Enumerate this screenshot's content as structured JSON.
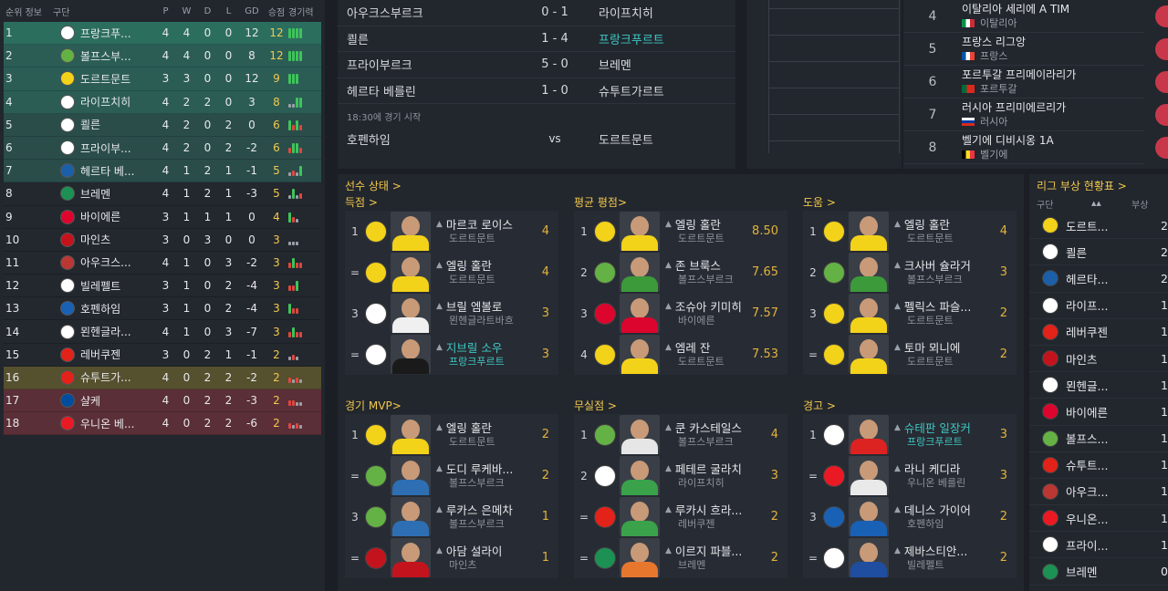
{
  "league_table": {
    "headers": {
      "pos": "순위",
      "info": "정보",
      "team": "구단",
      "p": "P",
      "w": "W",
      "d": "D",
      "l": "L",
      "gd": "GD",
      "pts": "승점",
      "form": "경기력"
    },
    "rows": [
      {
        "pos": "1",
        "team": "프랑크푸...",
        "crest": "eintracht-crest",
        "crest_color": "#ffffff",
        "p": "4",
        "w": "4",
        "d": "0",
        "l": "0",
        "gd": "12",
        "pts": "12",
        "row_bg": "#2c6e5e",
        "form": [
          "w",
          "w",
          "w",
          "w"
        ]
      },
      {
        "pos": "2",
        "team": "볼프스부...",
        "crest": "wolfsburg-crest",
        "crest_color": "#64b245",
        "p": "4",
        "w": "4",
        "d": "0",
        "l": "0",
        "gd": "8",
        "pts": "12",
        "row_bg": "#2b5d55",
        "form": [
          "w",
          "w",
          "w",
          "w"
        ]
      },
      {
        "pos": "3",
        "team": "도르트문트",
        "crest": "dortmund-crest",
        "crest_color": "#f3d21a",
        "p": "3",
        "w": "3",
        "d": "0",
        "l": "0",
        "gd": "12",
        "pts": "9",
        "row_bg": "#2b5d55",
        "form": [
          "w",
          "w",
          "w"
        ]
      },
      {
        "pos": "4",
        "team": "라이프치히",
        "crest": "leipzig-crest",
        "crest_color": "#ffffff",
        "p": "4",
        "w": "2",
        "d": "2",
        "l": "0",
        "gd": "3",
        "pts": "8",
        "row_bg": "#2b5d55",
        "form": [
          "d",
          "d",
          "w",
          "w"
        ]
      },
      {
        "pos": "5",
        "team": "쾰른",
        "crest": "koln-crest",
        "crest_color": "#ffffff",
        "p": "4",
        "w": "2",
        "d": "0",
        "l": "2",
        "gd": "0",
        "pts": "6",
        "row_bg": "#2a4d4a",
        "form": [
          "w",
          "l",
          "w",
          "l"
        ]
      },
      {
        "pos": "6",
        "team": "프라이부...",
        "crest": "freiburg-crest",
        "crest_color": "#ffffff",
        "p": "4",
        "w": "2",
        "d": "0",
        "l": "2",
        "gd": "-2",
        "pts": "6",
        "row_bg": "#2a4d4a",
        "form": [
          "l",
          "w",
          "w",
          "l"
        ]
      },
      {
        "pos": "7",
        "team": "헤르타 베...",
        "crest": "hertha-crest",
        "crest_color": "#1b5fa8",
        "p": "4",
        "w": "1",
        "d": "2",
        "l": "1",
        "gd": "-1",
        "pts": "5",
        "row_bg": "#2a4d4a",
        "form": [
          "d",
          "l",
          "d",
          "w"
        ]
      },
      {
        "pos": "8",
        "team": "브레멘",
        "crest": "bremen-crest",
        "crest_color": "#1d9053",
        "p": "4",
        "w": "1",
        "d": "2",
        "l": "1",
        "gd": "-3",
        "pts": "5",
        "row_bg": "#23272e",
        "form": [
          "d",
          "w",
          "d",
          "l"
        ]
      },
      {
        "pos": "9",
        "team": "바이에른",
        "crest": "bayern-crest",
        "crest_color": "#dc052d",
        "p": "3",
        "w": "1",
        "d": "1",
        "l": "1",
        "gd": "0",
        "pts": "4",
        "row_bg": "#23272e",
        "form": [
          "w",
          "l",
          "d"
        ]
      },
      {
        "pos": "10",
        "team": "마인츠",
        "crest": "mainz-crest",
        "crest_color": "#c3141e",
        "p": "3",
        "w": "0",
        "d": "3",
        "l": "0",
        "gd": "0",
        "pts": "3",
        "row_bg": "#23272e",
        "form": [
          "d",
          "d",
          "d"
        ]
      },
      {
        "pos": "11",
        "team": "아우크스...",
        "crest": "augsburg-crest",
        "crest_color": "#ba3733",
        "p": "4",
        "w": "1",
        "d": "0",
        "l": "3",
        "gd": "-2",
        "pts": "3",
        "row_bg": "#23272e",
        "form": [
          "l",
          "w",
          "l",
          "l"
        ]
      },
      {
        "pos": "12",
        "team": "빌레펠트",
        "crest": "bielefeld-crest",
        "crest_color": "#ffffff",
        "p": "3",
        "w": "1",
        "d": "0",
        "l": "2",
        "gd": "-4",
        "pts": "3",
        "row_bg": "#23272e",
        "form": [
          "l",
          "l",
          "w"
        ]
      },
      {
        "pos": "13",
        "team": "호펜하임",
        "crest": "hoffenheim-crest",
        "crest_color": "#1961b5",
        "p": "3",
        "w": "1",
        "d": "0",
        "l": "2",
        "gd": "-4",
        "pts": "3",
        "row_bg": "#23272e",
        "form": [
          "w",
          "l",
          "l"
        ]
      },
      {
        "pos": "14",
        "team": "묀헨글라...",
        "crest": "gladbach-crest",
        "crest_color": "#ffffff",
        "p": "4",
        "w": "1",
        "d": "0",
        "l": "3",
        "gd": "-7",
        "pts": "3",
        "row_bg": "#23272e",
        "form": [
          "l",
          "w",
          "l",
          "l"
        ]
      },
      {
        "pos": "15",
        "team": "레버쿠젠",
        "crest": "leverkusen-crest",
        "crest_color": "#e32219",
        "p": "3",
        "w": "0",
        "d": "2",
        "l": "1",
        "gd": "-1",
        "pts": "2",
        "row_bg": "#23272e",
        "form": [
          "d",
          "l",
          "d"
        ]
      },
      {
        "pos": "16",
        "team": "슈투트가...",
        "crest": "stuttgart-crest",
        "crest_color": "#e32219",
        "p": "4",
        "w": "0",
        "d": "2",
        "l": "2",
        "gd": "-2",
        "pts": "2",
        "row_bg": "#55502e",
        "form": [
          "l",
          "d",
          "l",
          "d"
        ]
      },
      {
        "pos": "17",
        "team": "샬케",
        "crest": "schalke-crest",
        "crest_color": "#004d9d",
        "p": "4",
        "w": "0",
        "d": "2",
        "l": "2",
        "gd": "-3",
        "pts": "2",
        "row_bg": "#5b2f37",
        "form": [
          "l",
          "l",
          "d",
          "d"
        ]
      },
      {
        "pos": "18",
        "team": "우니온 베...",
        "crest": "union-crest",
        "crest_color": "#eb1923",
        "p": "4",
        "w": "0",
        "d": "2",
        "l": "2",
        "gd": "-6",
        "pts": "2",
        "row_bg": "#5b2f37",
        "form": [
          "l",
          "d",
          "l",
          "d"
        ]
      }
    ]
  },
  "fixtures": {
    "rows": [
      {
        "home": "아우크스부르크",
        "score": "0 - 1",
        "away": "라이프치히",
        "away_hl": false
      },
      {
        "home": "쾰른",
        "score": "1 - 4",
        "away": "프랑크푸르트",
        "away_hl": true
      },
      {
        "home": "프라이부르크",
        "score": "5 - 0",
        "away": "브레멘",
        "away_hl": false
      },
      {
        "home": "헤르타 베를린",
        "score": "1 - 0",
        "away": "슈투트가르트",
        "away_hl": false
      }
    ],
    "note": "18:30에 경기 시작",
    "upcoming": {
      "home": "호펜하임",
      "vs": "vs",
      "away": "도르트문트"
    }
  },
  "rankings": [
    {
      "num": "4",
      "name": "이탈리아 세리에 A TIM",
      "country": "이탈리아",
      "flag": "italy-flag"
    },
    {
      "num": "5",
      "name": "프랑스 리그앙",
      "country": "프랑스",
      "flag": "france-flag"
    },
    {
      "num": "6",
      "name": "포르투갈 프리메이라리가",
      "country": "포르투갈",
      "flag": "portugal-flag"
    },
    {
      "num": "7",
      "name": "러시아 프리미에르리가",
      "country": "러시아",
      "flag": "russia-flag"
    },
    {
      "num": "8",
      "name": "벨기에 디비시옹 1A",
      "country": "벨기에",
      "flag": "belgium-flag"
    }
  ],
  "stats": {
    "title": "선수 상태 >",
    "categories": [
      {
        "title": "득점  >",
        "players": [
          {
            "rank": "1",
            "crest": "dortmund-crest",
            "crest_color": "#f3d21a",
            "shirt": "#f3d21a",
            "name": "마르코 로이스",
            "team": "도르트문트",
            "value": "4",
            "hl": false
          },
          {
            "rank": "=",
            "crest": "dortmund-crest",
            "crest_color": "#f3d21a",
            "shirt": "#f3d21a",
            "name": "엘링 홀란",
            "team": "도르트문트",
            "value": "4",
            "hl": false
          },
          {
            "rank": "3",
            "crest": "gladbach-crest",
            "crest_color": "#ffffff",
            "shirt": "#f0f0f0",
            "name": "브릴 엠볼로",
            "team": "묀헨글라트바흐",
            "value": "3",
            "hl": false
          },
          {
            "rank": "=",
            "crest": "eintracht-crest",
            "crest_color": "#ffffff",
            "shirt": "#1a1a1a",
            "name": "지브릴 소우",
            "team": "프랑크푸르트",
            "value": "3",
            "hl": true
          }
        ]
      },
      {
        "title": "평균 평점>",
        "players": [
          {
            "rank": "1",
            "crest": "dortmund-crest",
            "crest_color": "#f3d21a",
            "shirt": "#f3d21a",
            "name": "엘링 홀란",
            "team": "도르트문트",
            "value": "8.50",
            "hl": false
          },
          {
            "rank": "2",
            "crest": "wolfsburg-crest",
            "crest_color": "#64b245",
            "shirt": "#3d9a3a",
            "name": "존 브룩스",
            "team": "볼프스부르크",
            "value": "7.65",
            "hl": false
          },
          {
            "rank": "3",
            "crest": "bayern-crest",
            "crest_color": "#dc052d",
            "shirt": "#dc052d",
            "name": "조슈아 키미히",
            "team": "바이에른",
            "value": "7.57",
            "hl": false
          },
          {
            "rank": "4",
            "crest": "dortmund-crest",
            "crest_color": "#f3d21a",
            "shirt": "#f3d21a",
            "name": "엠레 잔",
            "team": "도르트문트",
            "value": "7.53",
            "hl": false
          }
        ]
      },
      {
        "title": "도움  >",
        "players": [
          {
            "rank": "1",
            "crest": "dortmund-crest",
            "crest_color": "#f3d21a",
            "shirt": "#f3d21a",
            "name": "엘링 홀란",
            "team": "도르트문트",
            "value": "4",
            "hl": false
          },
          {
            "rank": "2",
            "crest": "wolfsburg-crest",
            "crest_color": "#64b245",
            "shirt": "#3d9a3a",
            "name": "크사버 슐라거",
            "team": "볼프스부르크",
            "value": "3",
            "hl": false
          },
          {
            "rank": "3",
            "crest": "dortmund-crest",
            "crest_color": "#f3d21a",
            "shirt": "#f3d21a",
            "name": "펠릭스 파슬...",
            "team": "도르트문트",
            "value": "2",
            "hl": false
          },
          {
            "rank": "=",
            "crest": "dortmund-crest",
            "crest_color": "#f3d21a",
            "shirt": "#f3d21a",
            "name": "토마 뫼니에",
            "team": "도르트문트",
            "value": "2",
            "hl": false
          }
        ]
      },
      {
        "title": "경기 MVP>",
        "players": [
          {
            "rank": "1",
            "crest": "dortmund-crest",
            "crest_color": "#f3d21a",
            "shirt": "#f3d21a",
            "name": "엘링 홀란",
            "team": "도르트문트",
            "value": "2",
            "hl": false
          },
          {
            "rank": "=",
            "crest": "wolfsburg-crest",
            "crest_color": "#64b245",
            "shirt": "#2e6fb3",
            "name": "도디 루케바...",
            "team": "볼프스부르크",
            "value": "2",
            "hl": false
          },
          {
            "rank": "3",
            "crest": "wolfsburg-crest",
            "crest_color": "#64b245",
            "shirt": "#2e6fb3",
            "name": "루카스 은메차",
            "team": "볼프스부르크",
            "value": "1",
            "hl": false
          },
          {
            "rank": "=",
            "crest": "mainz-crest",
            "crest_color": "#c3141e",
            "shirt": "#c3141e",
            "name": "아담 설라이",
            "team": "마인츠",
            "value": "1",
            "hl": false
          }
        ]
      },
      {
        "title": "무실점 >",
        "players": [
          {
            "rank": "1",
            "crest": "wolfsburg-crest",
            "crest_color": "#64b245",
            "shirt": "#e6e6e6",
            "name": "쿤 카스테일스",
            "team": "볼프스부르크",
            "value": "4",
            "hl": false
          },
          {
            "rank": "2",
            "crest": "leipzig-crest",
            "crest_color": "#ffffff",
            "shirt": "#3aa24a",
            "name": "페테르 굴라치",
            "team": "라이프치히",
            "value": "3",
            "hl": false
          },
          {
            "rank": "=",
            "crest": "leverkusen-crest",
            "crest_color": "#e32219",
            "shirt": "#3aa24a",
            "name": "루카시 흐라...",
            "team": "레버쿠젠",
            "value": "2",
            "hl": false
          },
          {
            "rank": "=",
            "crest": "bremen-crest",
            "crest_color": "#1d9053",
            "shirt": "#e8772e",
            "name": "이르지 파블...",
            "team": "브레멘",
            "value": "2",
            "hl": false
          }
        ]
      },
      {
        "title": "경고  >",
        "players": [
          {
            "rank": "1",
            "crest": "eintracht-crest",
            "crest_color": "#ffffff",
            "shirt": "#d22",
            "name": "슈테판 일장커",
            "team": "프랑크푸르트",
            "value": "3",
            "hl": true
          },
          {
            "rank": "=",
            "crest": "union-crest",
            "crest_color": "#eb1923",
            "shirt": "#e9e9e9",
            "name": "라니 케디라",
            "team": "우니온 베를린",
            "value": "3",
            "hl": false
          },
          {
            "rank": "3",
            "crest": "hoffenheim-crest",
            "crest_color": "#1961b5",
            "shirt": "#1961b5",
            "name": "데니스 가이어",
            "team": "호펜하임",
            "value": "2",
            "hl": false
          },
          {
            "rank": "=",
            "crest": "bielefeld-crest",
            "crest_color": "#ffffff",
            "shirt": "#1f4ea0",
            "name": "제바스티안...",
            "team": "빌레펠트",
            "value": "2",
            "hl": false
          }
        ]
      }
    ]
  },
  "injury": {
    "title": "리그 부상 현황표 >",
    "head_team": "구단",
    "head_count": "부상",
    "sort_icon": "▲▲",
    "rows": [
      {
        "team": "도르트...",
        "crest": "dortmund-crest",
        "crest_color": "#f3d21a",
        "count": "2"
      },
      {
        "team": "쾰른",
        "crest": "koln-crest",
        "crest_color": "#ffffff",
        "count": "2"
      },
      {
        "team": "헤르타...",
        "crest": "hertha-crest",
        "crest_color": "#1b5fa8",
        "count": "2"
      },
      {
        "team": "라이프...",
        "crest": "leipzig-crest",
        "crest_color": "#ffffff",
        "count": "1"
      },
      {
        "team": "레버쿠젠",
        "crest": "leverkusen-crest",
        "crest_color": "#e32219",
        "count": "1"
      },
      {
        "team": "마인츠",
        "crest": "mainz-crest",
        "crest_color": "#c3141e",
        "count": "1"
      },
      {
        "team": "묀헨글...",
        "crest": "gladbach-crest",
        "crest_color": "#ffffff",
        "count": "1"
      },
      {
        "team": "바이에른",
        "crest": "bayern-crest",
        "crest_color": "#dc052d",
        "count": "1"
      },
      {
        "team": "볼프스...",
        "crest": "wolfsburg-crest",
        "crest_color": "#64b245",
        "count": "1"
      },
      {
        "team": "슈투트...",
        "crest": "stuttgart-crest",
        "crest_color": "#e32219",
        "count": "1"
      },
      {
        "team": "아우크...",
        "crest": "augsburg-crest",
        "crest_color": "#ba3733",
        "count": "1"
      },
      {
        "team": "우니온...",
        "crest": "union-crest",
        "crest_color": "#eb1923",
        "count": "1"
      },
      {
        "team": "프라이...",
        "crest": "freiburg-crest",
        "crest_color": "#ffffff",
        "count": "1"
      },
      {
        "team": "브레멘",
        "crest": "bremen-crest",
        "crest_color": "#1d9053",
        "count": "0"
      }
    ]
  },
  "colors": {
    "accent": "#f2c94c",
    "highlight": "#3fc8c4",
    "win": "#3ec45a",
    "draw": "#9aa0a8",
    "loss": "#e0463f"
  }
}
